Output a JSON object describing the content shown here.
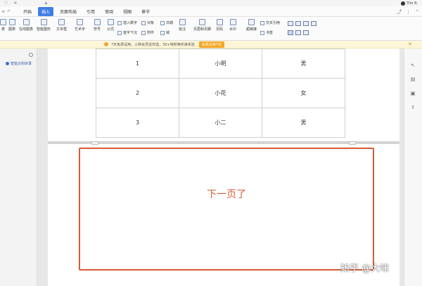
{
  "titlebar": {
    "user_name": "Tim R."
  },
  "menu": {
    "items": [
      "开始",
      "插入",
      "页面布局",
      "引用",
      "审阅",
      "视图",
      "章节"
    ],
    "active_index": 1
  },
  "ribbon": {
    "buttons": {
      "table": "表",
      "chart": "图表",
      "online_chart": "在线图表",
      "smart_shape": "智能图形",
      "textbox": "文本框",
      "art_text": "艺术字",
      "symbol": "符号",
      "formula": "公式",
      "header_footer": "页眉和页脚",
      "page_number": "页码",
      "watermark": "水印",
      "annotation": "批注",
      "hyperlink": "超链接",
      "bookmark": "书签",
      "cross_ref": "交叉引用"
    },
    "small": {
      "insert_number": "插入数字",
      "object": "对象",
      "date": "日期",
      "drop_cap": "首字下沉",
      "attachment": "附件",
      "field": "域"
    }
  },
  "notice": {
    "text": "7天免费试用，三种会员任你选，30+特权等你来体验",
    "button": "免费试用7天"
  },
  "left_panel": {
    "item": "智能识别目录"
  },
  "table": {
    "rows": [
      [
        "1",
        "小明",
        "男"
      ],
      [
        "2",
        "小花",
        "女"
      ],
      [
        "3",
        "小二",
        "男"
      ]
    ]
  },
  "page2": {
    "text": "下一页了"
  },
  "watermark": "知乎 @大咪",
  "colors": {
    "accent": "#3f7fe5",
    "red": "#d65c34",
    "notice_bg": "#fdf6d9"
  }
}
